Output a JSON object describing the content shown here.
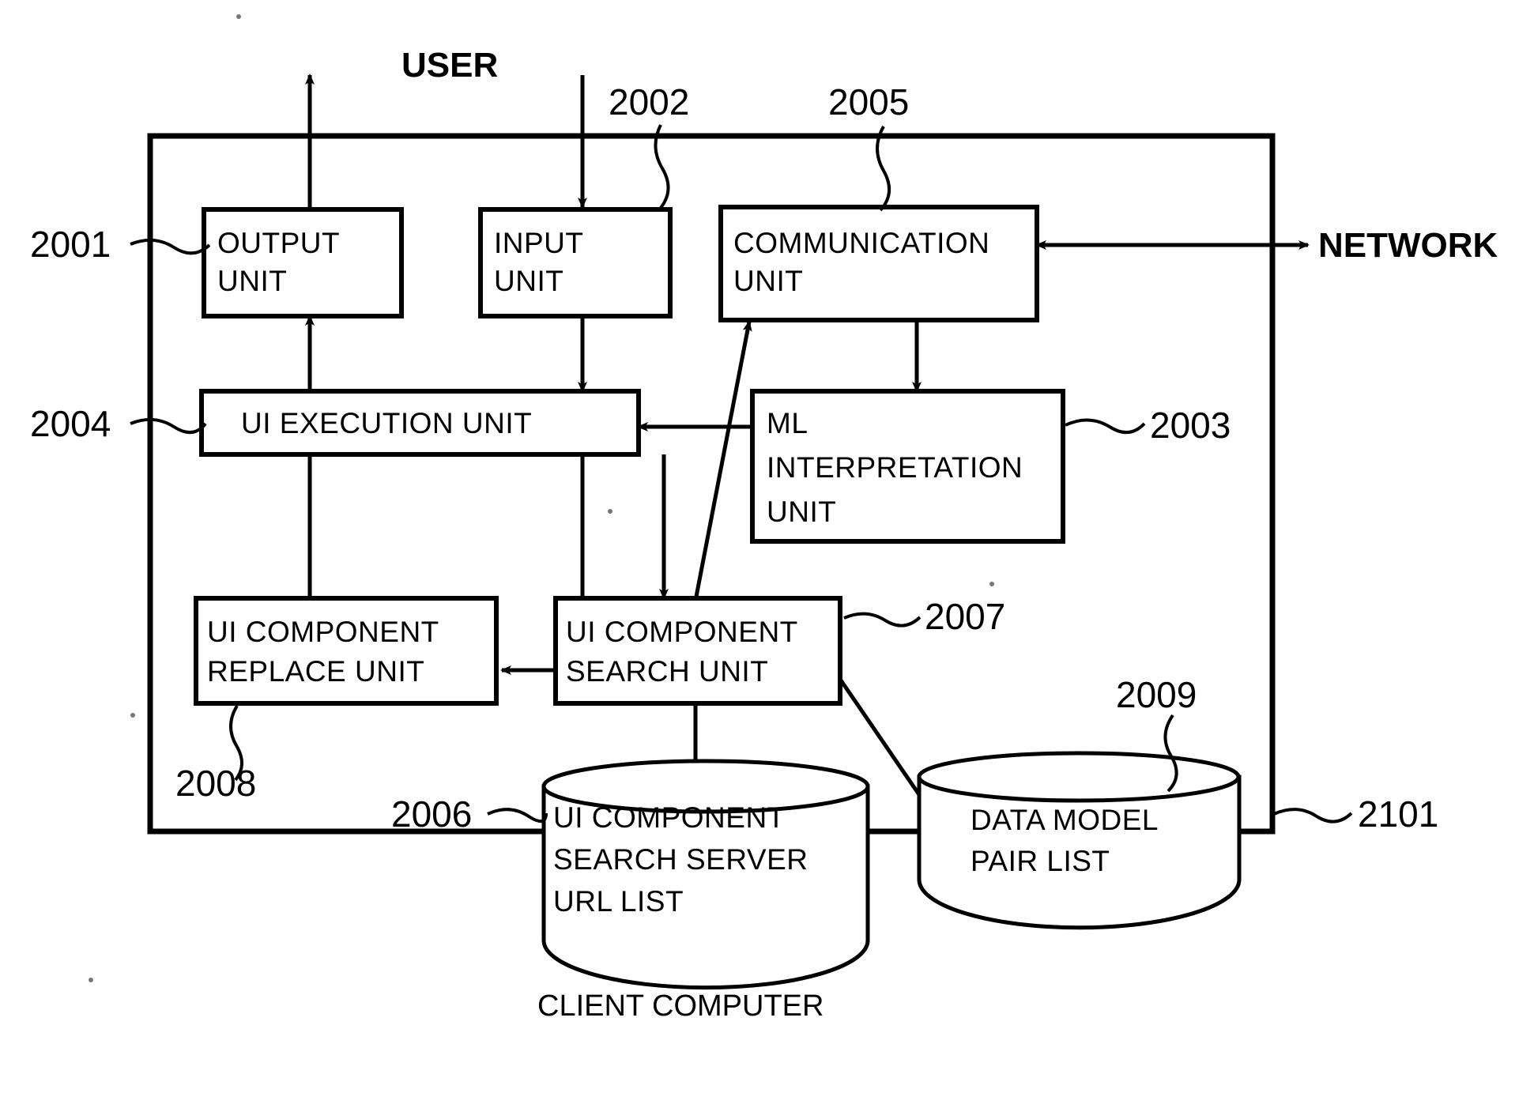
{
  "figure": {
    "container_label": "CLIENT COMPUTER",
    "external_labels": {
      "user": "USER",
      "network": "NETWORK"
    }
  },
  "blocks": [
    {
      "id": "output_unit",
      "ref": "2001",
      "lines": [
        "OUTPUT",
        "UNIT"
      ]
    },
    {
      "id": "input_unit",
      "ref": "2002",
      "lines": [
        "INPUT",
        "UNIT"
      ]
    },
    {
      "id": "communication_unit",
      "ref": "2005",
      "lines": [
        "COMMUNICATION",
        "UNIT"
      ]
    },
    {
      "id": "ui_execution_unit",
      "ref": "2004",
      "lines": [
        "UI EXECUTION UNIT"
      ]
    },
    {
      "id": "ml_interpretation_unit",
      "ref": "2003",
      "lines": [
        "ML",
        "INTERPRETATION",
        "UNIT"
      ]
    },
    {
      "id": "ui_component_replace_unit",
      "ref": "2008",
      "lines": [
        "UI COMPONENT",
        "REPLACE UNIT"
      ]
    },
    {
      "id": "ui_component_search_unit",
      "ref": "2007",
      "lines": [
        "UI COMPONENT",
        "SEARCH UNIT"
      ]
    }
  ],
  "datastores": [
    {
      "id": "ui_component_search_server_url_list",
      "ref": "2006",
      "lines": [
        "UI COMPONENT",
        "SEARCH SERVER",
        "URL LIST"
      ]
    },
    {
      "id": "data_model_pair_list",
      "ref": "2009",
      "lines": [
        "DATA MODEL",
        "PAIR LIST"
      ]
    }
  ],
  "references": {
    "r2001": "2001",
    "r2002": "2002",
    "r2003": "2003",
    "r2004": "2004",
    "r2005": "2005",
    "r2006": "2006",
    "r2007": "2007",
    "r2008": "2008",
    "r2009": "2009",
    "r2101": "2101"
  },
  "text": {
    "output_l1": "OUTPUT",
    "output_l2": "UNIT",
    "input_l1": "INPUT",
    "input_l2": "UNIT",
    "comm_l1": "COMMUNICATION",
    "comm_l2": "UNIT",
    "exec_l1": "UI EXECUTION UNIT",
    "ml_l1": "ML",
    "ml_l2": "INTERPRETATION",
    "ml_l3": "UNIT",
    "replace_l1": "UI COMPONENT",
    "replace_l2": "REPLACE UNIT",
    "search_l1": "UI COMPONENT",
    "search_l2": "SEARCH UNIT",
    "urllist_l1": "UI COMPONENT",
    "urllist_l2": "SEARCH SERVER",
    "urllist_l3": "URL LIST",
    "pairlist_l1": "DATA MODEL",
    "pairlist_l2": "PAIR LIST",
    "user": "USER",
    "network": "NETWORK",
    "client_computer": "CLIENT COMPUTER"
  },
  "colors": {
    "stroke": "#000000",
    "background": "#ffffff"
  }
}
